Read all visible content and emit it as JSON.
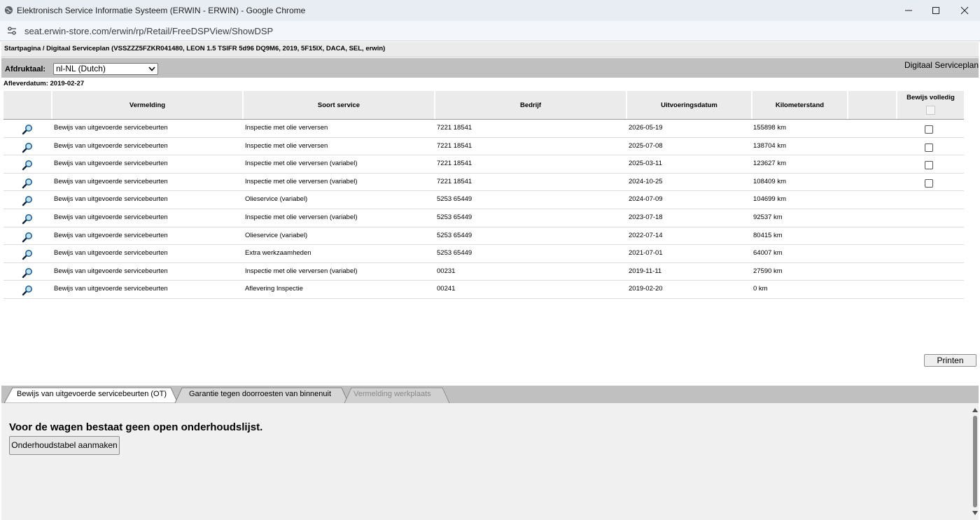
{
  "window": {
    "title": "Elektronisch Service Informatie Systeem (ERWIN - ERWIN) - Google Chrome",
    "url": "seat.erwin-store.com/erwin/rp/Retail/FreeDSPView/ShowDSP"
  },
  "breadcrumb": "Startpagina / Digitaal Serviceplan (VSSZZZ5FZKR041480, LEON 1.5 TSIFR 5d96 DQ9M6, 2019, 5F15IX, DACA, SEL, erwin)",
  "language": {
    "label": "Afdruktaal:",
    "selected": "nl-NL (Dutch)",
    "section_title": "Digitaal Serviceplan"
  },
  "delivery": {
    "label": "Afleverdatum:",
    "date": "2019-02-27"
  },
  "table": {
    "headers": [
      "Vermelding",
      "Soort service",
      "Bedrijf",
      "Uitvoeringsdatum",
      "Kilometerstand",
      "Bewijs volledig"
    ],
    "rows": [
      {
        "vermelding": "Bewijs van uitgevoerde servicebeurten",
        "soort": "Inspectie met olie verversen",
        "bedrijf": "7221 18541",
        "datum": "2026-05-19",
        "km": "155898 km",
        "checkbox": true
      },
      {
        "vermelding": "Bewijs van uitgevoerde servicebeurten",
        "soort": "Inspectie met olie verversen",
        "bedrijf": "7221 18541",
        "datum": "2025-07-08",
        "km": "138704 km",
        "checkbox": true
      },
      {
        "vermelding": "Bewijs van uitgevoerde servicebeurten",
        "soort": "Inspectie met olie verversen (variabel)",
        "bedrijf": "7221 18541",
        "datum": "2025-03-11",
        "km": "123627 km",
        "checkbox": true
      },
      {
        "vermelding": "Bewijs van uitgevoerde servicebeurten",
        "soort": "Inspectie met olie verversen (variabel)",
        "bedrijf": "7221 18541",
        "datum": "2024-10-25",
        "km": "108409 km",
        "checkbox": true
      },
      {
        "vermelding": "Bewijs van uitgevoerde servicebeurten",
        "soort": "Olieservice (variabel)",
        "bedrijf": "5253 65449",
        "datum": "2024-07-09",
        "km": "104699 km",
        "checkbox": false
      },
      {
        "vermelding": "Bewijs van uitgevoerde servicebeurten",
        "soort": "Inspectie met olie verversen (variabel)",
        "bedrijf": "5253 65449",
        "datum": "2023-07-18",
        "km": "92537 km",
        "checkbox": false
      },
      {
        "vermelding": "Bewijs van uitgevoerde servicebeurten",
        "soort": "Olieservice (variabel)",
        "bedrijf": "5253 65449",
        "datum": "2022-07-14",
        "km": "80415 km",
        "checkbox": false
      },
      {
        "vermelding": "Bewijs van uitgevoerde servicebeurten",
        "soort": "Extra werkzaamheden",
        "bedrijf": "5253 65449",
        "datum": "2021-07-01",
        "km": "64007 km",
        "checkbox": false
      },
      {
        "vermelding": "Bewijs van uitgevoerde servicebeurten",
        "soort": "Inspectie met olie verversen (variabel)",
        "bedrijf": "00231",
        "datum": "2019-11-11",
        "km": "27590 km",
        "checkbox": false
      },
      {
        "vermelding": "Bewijs van uitgevoerde servicebeurten",
        "soort": "Aflevering Inspectie",
        "bedrijf": "00241",
        "datum": "2019-02-20",
        "km": "0 km",
        "checkbox": false
      }
    ]
  },
  "print_label": "Printen",
  "tabs": [
    {
      "label": "Bewijs van uitgevoerde servicebeurten (OT)",
      "state": "active"
    },
    {
      "label": "Garantie tegen doorroesten van binnenuit",
      "state": "normal"
    },
    {
      "label": "Vermelding werkplaats",
      "state": "disabled"
    }
  ],
  "panel": {
    "message": "Voor de wagen bestaat geen open onderhoudslijst.",
    "button": "Onderhoudstabel aanmaken"
  }
}
